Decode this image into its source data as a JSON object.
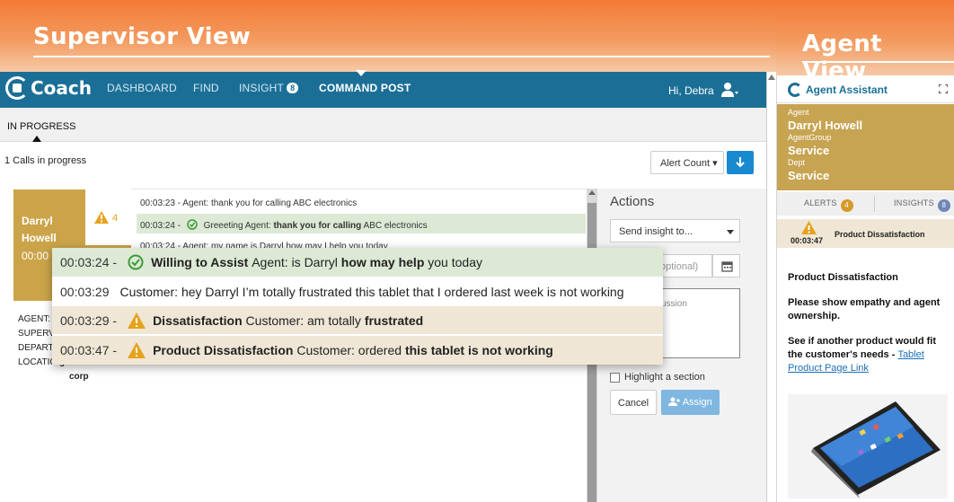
{
  "banners": {
    "supervisor_title": "Supervisor View",
    "agent_title": "Agent View"
  },
  "nav": {
    "logo": "Coach",
    "items": [
      {
        "label": "DASHBOARD"
      },
      {
        "label": "FIND"
      },
      {
        "label": "INSIGHT",
        "badge": "8"
      },
      {
        "label": "COMMAND POST",
        "active": true
      }
    ],
    "greeting": "Hi, Debra"
  },
  "subnav": {
    "tab": "IN PROGRESS"
  },
  "calls": {
    "count_text": "1 Calls in progress",
    "alert_button": "Alert Count",
    "alert_caret": "▾"
  },
  "agent_card": {
    "name": "Darryl Howell",
    "time": "00:00",
    "alert_count": "4",
    "color": "#cba44a"
  },
  "feed": [
    {
      "time": "00:03:23 -",
      "text": "Agent: thank you for calling ABC electronics"
    },
    {
      "time": "00:03:24 -",
      "tag": "Greeeting",
      "speaker": "Agent:",
      "bold": "thank you for calling",
      "rest": "ABC electronics"
    },
    {
      "time": "00:03:24 -",
      "text": "Agent: my name is Darryl how may I help you today"
    }
  ],
  "details": {
    "lines": [
      "AGENT:",
      "SUPERV",
      "DEPART",
      "LOCATIO"
    ],
    "location_value": "global",
    "location_value2": "corp"
  },
  "actions": {
    "title": "Actions",
    "send_placeholder": "Send insight to...",
    "date_placeholder": "optional)",
    "discuss_placeholder": "ussion",
    "highlight_label": "Highlight a section",
    "cancel": "Cancel",
    "assign": "Assign"
  },
  "overlay": [
    {
      "time": "00:03:24 -",
      "icon": "check",
      "tag": "Willing to Assist",
      "pre": "Agent: is Darryl",
      "bold": "how may help",
      "post": "you today"
    },
    {
      "time": "00:03:29",
      "icon": "none",
      "text": "Customer: hey Darryl I’m totally frustrated this tablet that I ordered last week is not working"
    },
    {
      "time": "00:03:29 -",
      "icon": "warning",
      "tag": "Dissatisfaction",
      "pre": "Customer: am totally",
      "bold": "frustrated",
      "post": ""
    },
    {
      "time": "00:03:47 -",
      "icon": "warning",
      "tag": "Product Dissatisfaction",
      "pre": "Customer: ordered",
      "bold": "this tablet is not working",
      "post": ""
    }
  ],
  "agent_assistant": {
    "title": "Agent Assistant",
    "agent_label": "Agent",
    "agent_value": "Darryl Howell",
    "group_label": "AgentGroup",
    "group_value": "Service",
    "dept_label": "Dept",
    "dept_value": "Service",
    "tab_alerts": "ALERTS",
    "tab_alerts_count": "4",
    "tab_insights": "INSIGHTS",
    "tab_insights_count": "8",
    "alert_time": "00:03:47",
    "alert_title": "Product Dissatisfaction",
    "body_title": "Product Dissatisfaction",
    "body_p1": "Please show empathy and agent ownership.",
    "body_p2": "See if another product would fit the customer's needs -",
    "body_link": "Tablet Product Page Link",
    "colors": {
      "brand": "#1b6f97",
      "gold": "#c7a451",
      "alert_bg": "#efe6d5",
      "ok_bg": "#dde9d5"
    }
  }
}
